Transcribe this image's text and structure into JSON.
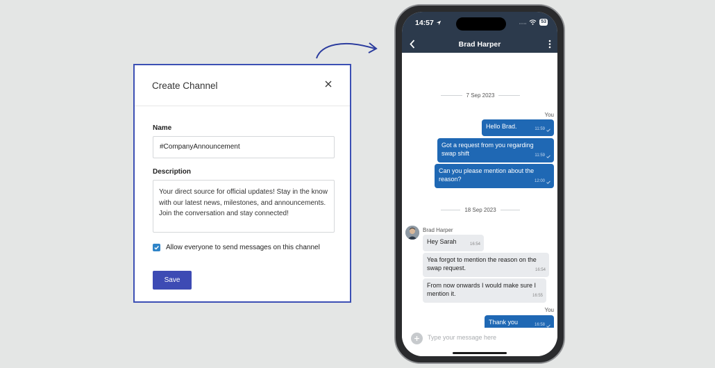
{
  "dialog": {
    "title": "Create Channel",
    "name_label": "Name",
    "name_value": "#CompanyAnnouncement",
    "description_label": "Description",
    "description_value": "Your direct source for official updates! Stay in the know with our latest news, milestones, and announcements. Join the conversation and stay connected!",
    "checkbox_label": "Allow everyone to send messages on this channel",
    "checkbox_checked": true,
    "save_label": "Save"
  },
  "phone": {
    "time": "14:57",
    "battery": "53",
    "contact": "Brad Harper",
    "date_1": "7 Sep 2023",
    "date_2": "18 Sep 2023",
    "you_label": "You",
    "outgoing_1": [
      {
        "text": "Hello Brad.",
        "time": "11:59"
      },
      {
        "text": "Got a request from you regarding swap shift",
        "time": "11:59"
      },
      {
        "text": "Can you please mention about the reason?",
        "time": "12:00"
      }
    ],
    "sender_name": "Brad Harper",
    "incoming": [
      {
        "text": "Hey Sarah",
        "time": "16:54"
      },
      {
        "text": "Yea forgot to mention the reason on the swap request.",
        "time": "16:54"
      },
      {
        "text": "From now onwards I would make sure I mention it.",
        "time": "16:55"
      }
    ],
    "outgoing_2": [
      {
        "text": "Thank you",
        "time": "16:58"
      }
    ],
    "composer_placeholder": "Type your message here"
  },
  "colors": {
    "accent": "#3d4bb4",
    "dialog_border": "#3b4fb4",
    "bubble_out": "#1f68b4",
    "bubble_in": "#e9ebee",
    "header": "#2c3a4c"
  }
}
